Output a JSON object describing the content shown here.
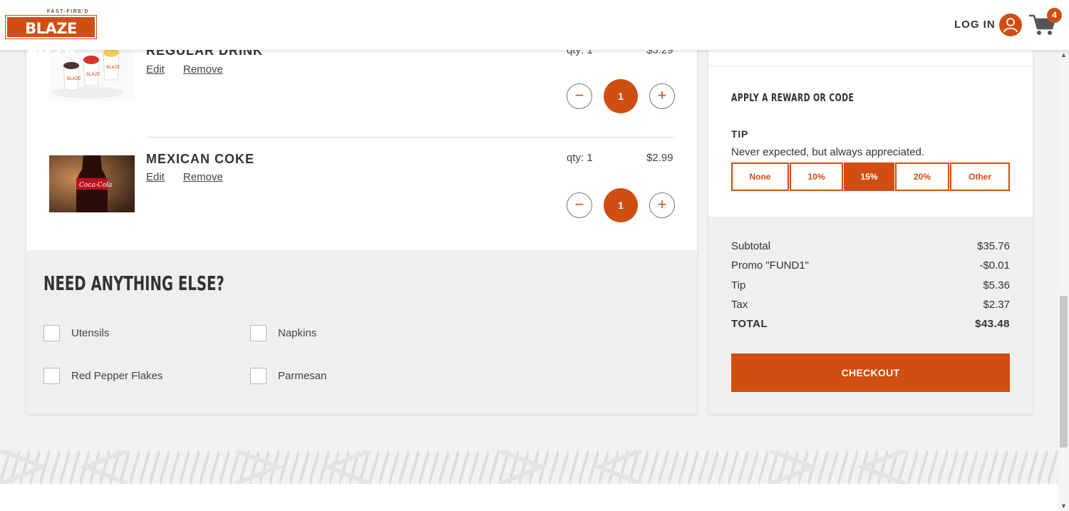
{
  "header": {
    "logo_tag": "FAST-FIRE'D",
    "logo_text": "BLAZE PIZZA",
    "login_label": "LOG IN",
    "cart_count": "4"
  },
  "cart_items": [
    {
      "name": "REGULAR DRINK",
      "edit_label": "Edit",
      "remove_label": "Remove",
      "qty_text": "qty: 1",
      "price": "$3.29",
      "quantity": "1"
    },
    {
      "name": "MEXICAN COKE",
      "edit_label": "Edit",
      "remove_label": "Remove",
      "qty_text": "qty: 1",
      "price": "$2.99",
      "quantity": "1"
    }
  ],
  "extras": {
    "title": "NEED ANYTHING ELSE?",
    "options": [
      "Utensils",
      "Napkins",
      "Red Pepper Flakes",
      "Parmesan"
    ]
  },
  "rewards": {
    "title": "APPLY A REWARD OR CODE"
  },
  "tip": {
    "title": "TIP",
    "subtitle": "Never expected, but always appreciated.",
    "options": [
      "None",
      "10%",
      "15%",
      "20%",
      "Other"
    ],
    "selected": "15%"
  },
  "summary": {
    "rows": [
      {
        "label": "Subtotal",
        "value": "$35.76"
      },
      {
        "label": "Promo \"FUND1\"",
        "value": "-$0.01"
      },
      {
        "label": "Tip",
        "value": "$5.36"
      },
      {
        "label": "Tax",
        "value": "$2.37"
      },
      {
        "label": "TOTAL",
        "value": "$43.48"
      }
    ],
    "checkout_label": "CHECKOUT"
  },
  "colors": {
    "brand": "#d04e11"
  }
}
